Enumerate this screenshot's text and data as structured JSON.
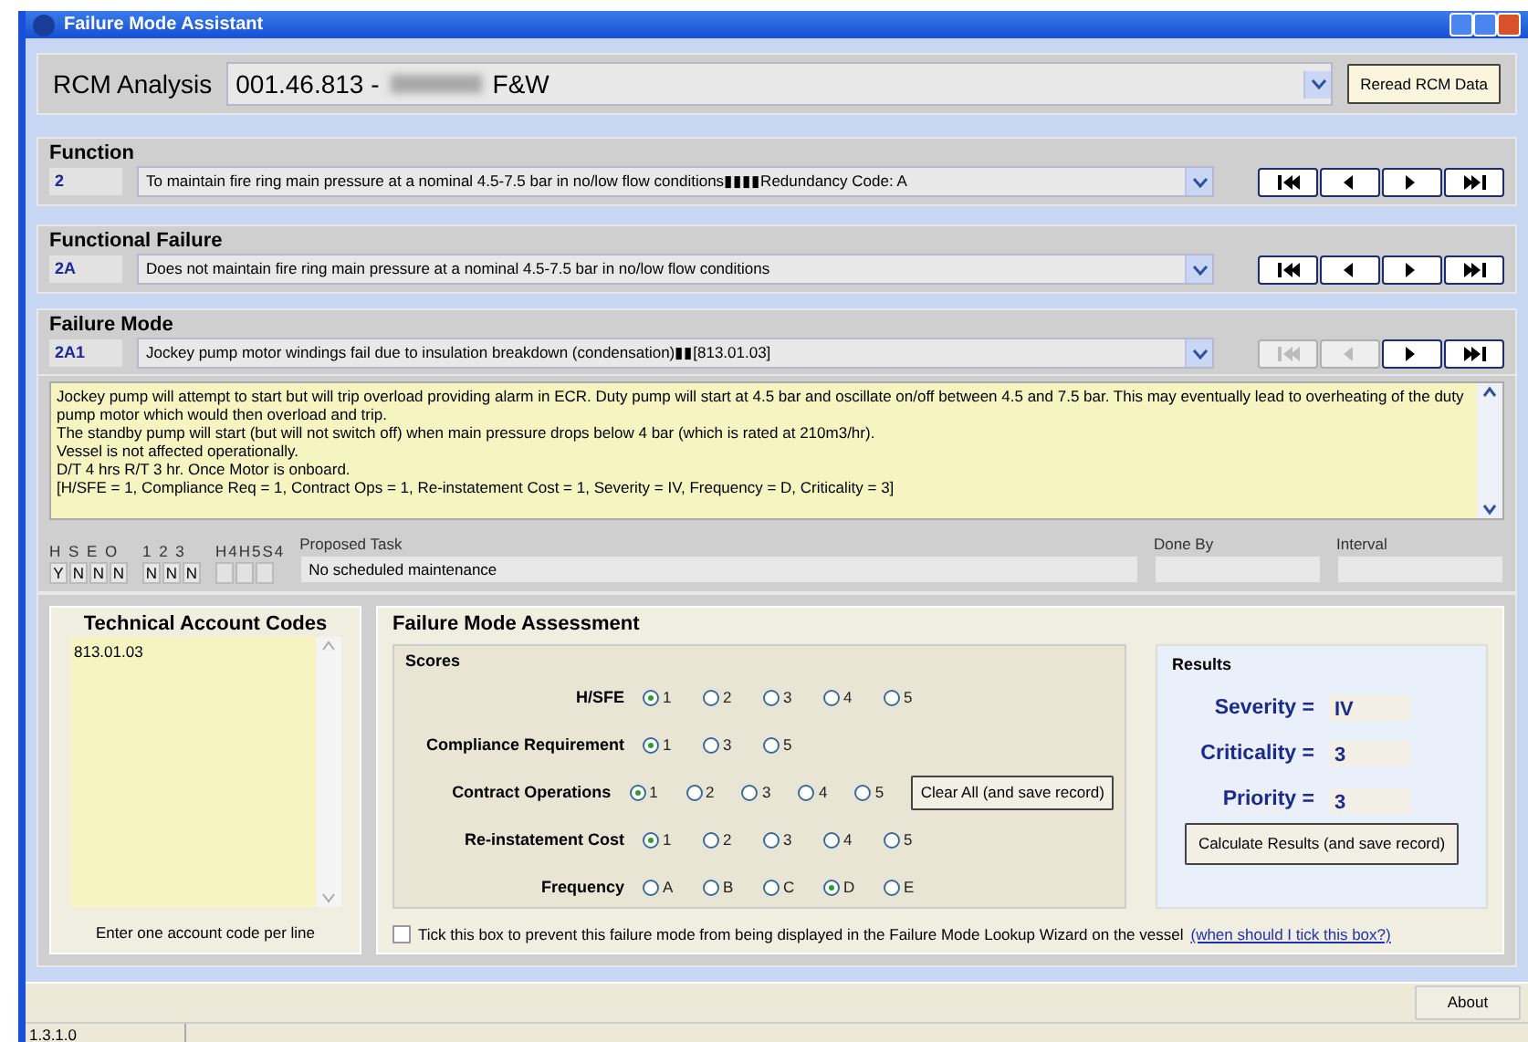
{
  "window": {
    "title": "Failure Mode Assistant"
  },
  "rcm": {
    "label": "RCM Analysis",
    "value_prefix": "001.46.813 -",
    "value_suffix": "F&W",
    "button": "Reread RCM Data"
  },
  "sections": [
    {
      "title": "Function",
      "code": "2",
      "value": "To maintain fire ring main pressure at a nominal 4.5-7.5 bar in no/low flow conditions▮▮▮▮Redundancy Code: A",
      "nav": [
        {
          "kind": "first",
          "disabled": false
        },
        {
          "kind": "prev",
          "disabled": false
        },
        {
          "kind": "next",
          "disabled": false
        },
        {
          "kind": "last",
          "disabled": false
        }
      ]
    },
    {
      "title": "Functional Failure",
      "code": "2A",
      "value": "Does not maintain fire ring main pressure at a nominal 4.5-7.5 bar in no/low flow conditions",
      "nav": [
        {
          "kind": "first",
          "disabled": false
        },
        {
          "kind": "prev",
          "disabled": false
        },
        {
          "kind": "next",
          "disabled": false
        },
        {
          "kind": "last",
          "disabled": false
        }
      ]
    },
    {
      "title": "Failure Mode",
      "code": "2A1",
      "value": "Jockey pump motor windings fail due to insulation breakdown (condensation)▮▮[813.01.03]",
      "nav": [
        {
          "kind": "first",
          "disabled": true
        },
        {
          "kind": "prev",
          "disabled": true
        },
        {
          "kind": "next",
          "disabled": false
        },
        {
          "kind": "last",
          "disabled": false
        }
      ]
    }
  ],
  "description": [
    "Jockey pump will attempt to start but will trip overload providing alarm in ECR. Duty pump will start at 4.5 bar and oscillate on/off between 4.5 and 7.5 bar. This may eventually lead to overheating of the duty pump motor which would then overload and trip.",
    "The standby pump will start (but will not switch off) when main pressure drops below 4 bar (which is rated at 210m3/hr).",
    "Vessel is not affected operationally.",
    "D/T 4 hrs R/T 3 hr. Once Motor is onboard.",
    "[H/SFE = 1, Compliance Req = 1, Contract Ops = 1, Re-instatement Cost = 1, Severity = IV, Frequency = D, Criticality = 3]"
  ],
  "flag_groups": [
    {
      "labels": "H S E O",
      "boxes": [
        {
          "kind": "value",
          "value": "Y"
        },
        {
          "kind": "value",
          "value": "N"
        },
        {
          "kind": "value",
          "value": "N"
        },
        {
          "kind": "value",
          "value": "N"
        }
      ]
    },
    {
      "labels": "1 2 3",
      "boxes": [
        {
          "kind": "value",
          "value": "N"
        },
        {
          "kind": "value",
          "value": "N"
        },
        {
          "kind": "value",
          "value": "N"
        }
      ]
    },
    {
      "labels": "H4H5S4",
      "boxes": [
        {
          "kind": "blank"
        },
        {
          "kind": "blank"
        },
        {
          "kind": "blank"
        }
      ]
    }
  ],
  "task": {
    "label": "Proposed Task",
    "value": "No scheduled maintenance"
  },
  "done_by": {
    "label": "Done By"
  },
  "interval": {
    "label": "Interval"
  },
  "account_codes": {
    "title": "Technical Account Codes",
    "value": "813.01.03",
    "hint": "Enter one account code per line"
  },
  "assessment": {
    "title": "Failure Mode Assessment",
    "scores_title": "Scores",
    "rows": [
      {
        "label": "H/SFE",
        "options": [
          {
            "label": "1",
            "selected": true
          },
          {
            "label": "2",
            "selected": false
          },
          {
            "label": "3",
            "selected": false
          },
          {
            "label": "4",
            "selected": false
          },
          {
            "label": "5",
            "selected": false
          }
        ]
      },
      {
        "label": "Compliance Requirement",
        "options": [
          {
            "label": "1",
            "selected": true
          },
          {
            "label": "3",
            "selected": false
          },
          {
            "label": "5",
            "selected": false
          }
        ]
      },
      {
        "label": "Contract Operations",
        "options": [
          {
            "label": "1",
            "selected": true
          },
          {
            "label": "2",
            "selected": false
          },
          {
            "label": "3",
            "selected": false
          },
          {
            "label": "4",
            "selected": false
          },
          {
            "label": "5",
            "selected": false
          }
        ],
        "button": "Clear All (and save record)"
      },
      {
        "label": "Re-instatement Cost",
        "options": [
          {
            "label": "1",
            "selected": true
          },
          {
            "label": "2",
            "selected": false
          },
          {
            "label": "3",
            "selected": false
          },
          {
            "label": "4",
            "selected": false
          },
          {
            "label": "5",
            "selected": false
          }
        ]
      },
      {
        "label": "Frequency",
        "options": [
          {
            "label": "A",
            "selected": false
          },
          {
            "label": "B",
            "selected": false
          },
          {
            "label": "C",
            "selected": false
          },
          {
            "label": "D",
            "selected": true
          },
          {
            "label": "E",
            "selected": false
          }
        ]
      }
    ]
  },
  "results": {
    "title": "Results",
    "items": [
      {
        "label": "Severity =",
        "value": "IV"
      },
      {
        "label": "Criticality =",
        "value": "3"
      },
      {
        "label": "Priority =",
        "value": "3"
      }
    ],
    "button": "Calculate Results (and save record)"
  },
  "hide_option": {
    "label": "Tick this box to prevent this failure mode from being displayed in the Failure Mode Lookup Wizard on the vessel",
    "checked": false,
    "link": "(when should I tick this box?)"
  },
  "about_button": "About",
  "status_bar": {
    "version": "1.3.1.0"
  }
}
